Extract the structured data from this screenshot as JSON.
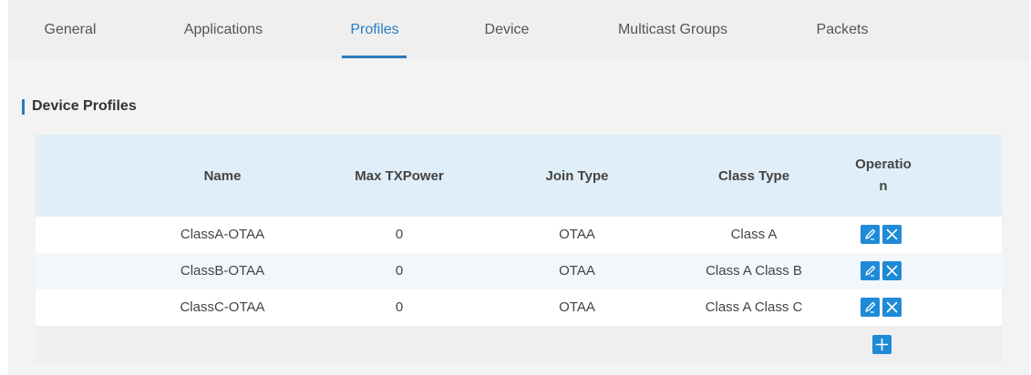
{
  "tabs": [
    {
      "label": "General"
    },
    {
      "label": "Applications"
    },
    {
      "label": "Profiles"
    },
    {
      "label": "Device"
    },
    {
      "label": "Multicast Groups"
    },
    {
      "label": "Packets"
    }
  ],
  "active_tab": "Profiles",
  "section": {
    "title": "Device Profiles"
  },
  "table": {
    "headers": {
      "name": "Name",
      "max_txpower": "Max TXPower",
      "join_type": "Join Type",
      "class_type": "Class Type",
      "operation": "Operation"
    },
    "rows": [
      {
        "name": "ClassA-OTAA",
        "max_txpower": "0",
        "join_type": "OTAA",
        "class_type": "Class A"
      },
      {
        "name": "ClassB-OTAA",
        "max_txpower": "0",
        "join_type": "OTAA",
        "class_type": "Class A Class B"
      },
      {
        "name": "ClassC-OTAA",
        "max_txpower": "0",
        "join_type": "OTAA",
        "class_type": "Class A Class C"
      }
    ]
  },
  "icons": {
    "edit": "edit-icon",
    "delete": "delete-icon",
    "add": "add-icon"
  },
  "colors": {
    "accent": "#2a7cbe",
    "button": "#1f8ad6",
    "header_bg": "#dfeef9"
  }
}
